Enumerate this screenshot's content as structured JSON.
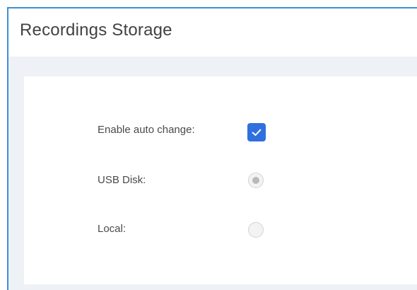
{
  "panel": {
    "title": "Recordings Storage"
  },
  "form": {
    "enable_auto_change": {
      "label": "Enable auto change:",
      "checked": true
    },
    "usb_disk": {
      "label": "USB Disk:",
      "selected": true,
      "disabled": true
    },
    "local": {
      "label": "Local:",
      "selected": false,
      "disabled": true
    }
  },
  "colors": {
    "accent": "#2f6fe0",
    "frame_border": "#3f8ed8",
    "content_bg": "#eef1f5"
  }
}
